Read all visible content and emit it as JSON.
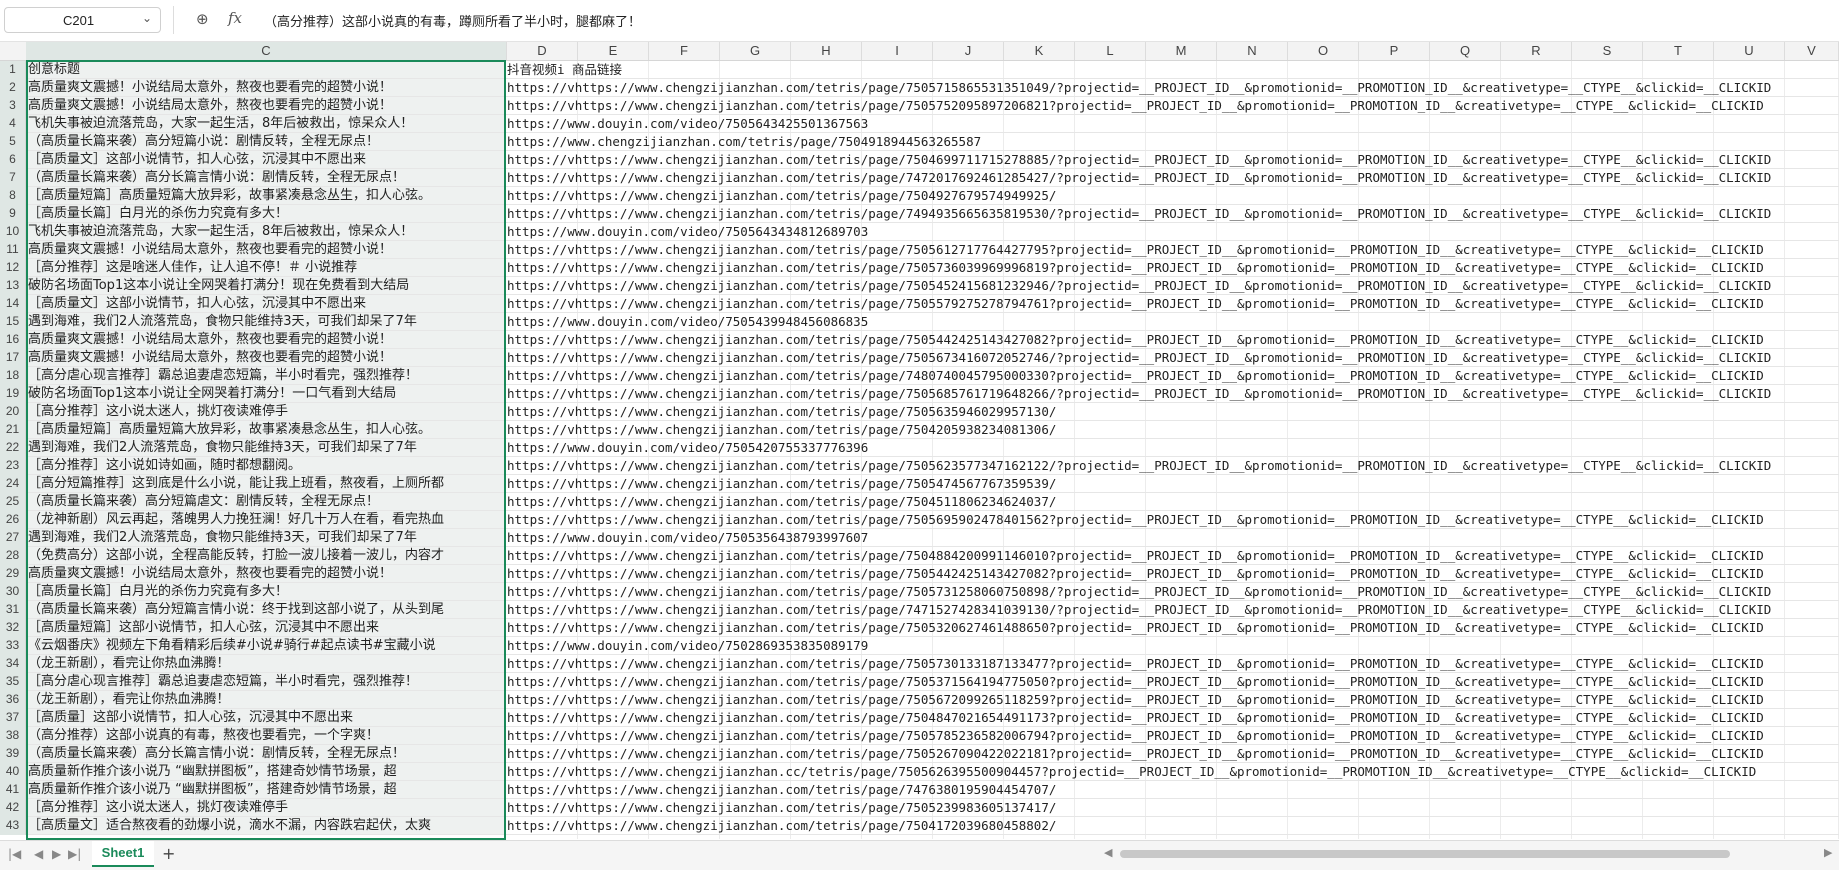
{
  "formula_bar": {
    "cell_ref": "C201",
    "dropdown_icon": "chevron-down-icon",
    "zoom_icon": "zoom-icon",
    "fx_label": "fx",
    "formula": "（高分推荐）这部小说真的有毒，蹲厕所看了半小时，腿都麻了！"
  },
  "columns": [
    "C",
    "D",
    "E",
    "F",
    "G",
    "H",
    "I",
    "J",
    "K",
    "L",
    "M",
    "N",
    "O",
    "P",
    "Q",
    "R",
    "S",
    "T",
    "U",
    "V"
  ],
  "rows": [
    {
      "n": "1",
      "c": "创意标题",
      "d": "抖音视频i 商品链接"
    },
    {
      "n": "2",
      "c": "高质量爽文震撼！小说结局太意外，熬夜也要看完的超赞小说！",
      "d": "https://vhttps://www.chengzijianzhan.com/tetris/page/7505715865531351049/?projectid=__PROJECT_ID__&promotionid=__PROMOTION_ID__&creativetype=__CTYPE__&clickid=__CLICKID"
    },
    {
      "n": "3",
      "c": "高质量爽文震撼！小说结局太意外，熬夜也要看完的超赞小说！",
      "d": "https://vhttps://www.chengzijianzhan.com/tetris/page/7505752095897206821?projectid=__PROJECT_ID__&promotionid=__PROMOTION_ID__&creativetype=__CTYPE__&clickid=__CLICKID"
    },
    {
      "n": "4",
      "c": "飞机失事被迫流落荒岛，大家一起生活，8年后被救出，惊呆众人！",
      "d": "https://www.douyin.com/video/7505643425501367563"
    },
    {
      "n": "5",
      "c": "（高质量长篇来袭）高分短篇小说：剧情反转，全程无尿点！",
      "d": "https://www.chengzijianzhan.com/tetris/page/7504918944563265587"
    },
    {
      "n": "6",
      "c": "［高质量文］这部小说情节，扣人心弦，沉浸其中不愿出来",
      "d": "https://vhttps://www.chengzijianzhan.com/tetris/page/7504699711715278885/?projectid=__PROJECT_ID__&promotionid=__PROMOTION_ID__&creativetype=__CTYPE__&clickid=__CLICKID"
    },
    {
      "n": "7",
      "c": "（高质量长篇来袭）高分长篇言情小说：剧情反转，全程无尿点！",
      "d": "https://vhttps://www.chengzijianzhan.com/tetris/page/7472017692461285427/?projectid=__PROJECT_ID__&promotionid=__PROMOTION_ID__&creativetype=__CTYPE__&clickid=__CLICKID"
    },
    {
      "n": "8",
      "c": "［高质量短篇］高质量短篇大放异彩，故事紧凑悬念丛生，扣人心弦。",
      "d": "https://vhttps://www.chengzijianzhan.com/tetris/page/7504927679574949925/"
    },
    {
      "n": "9",
      "c": "［高质量长篇］白月光的杀伤力究竟有多大！",
      "d": "https://vhttps://www.chengzijianzhan.com/tetris/page/7494935665635819530/?projectid=__PROJECT_ID__&promotionid=__PROMOTION_ID__&creativetype=__CTYPE__&clickid=__CLICKID"
    },
    {
      "n": "10",
      "c": "飞机失事被迫流落荒岛，大家一起生活，8年后被救出，惊呆众人！",
      "d": "https://www.douyin.com/video/7505643434812689703"
    },
    {
      "n": "11",
      "c": "高质量爽文震撼！小说结局太意外，熬夜也要看完的超赞小说！",
      "d": "https://vhttps://www.chengzijianzhan.com/tetris/page/7505612717764427795?projectid=__PROJECT_ID__&promotionid=__PROMOTION_ID__&creativetype=__CTYPE__&clickid=__CLICKID"
    },
    {
      "n": "12",
      "c": "［高分推荐］这是啥迷人佳作，让人追不停！＃ 小说推荐",
      "d": "https://vhttps://www.chengzijianzhan.com/tetris/page/7505736039969996819?projectid=__PROJECT_ID__&promotionid=__PROMOTION_ID__&creativetype=__CTYPE__&clickid=__CLICKID"
    },
    {
      "n": "13",
      "c": "破防名场面Top1这本小说让全网哭着打满分！现在免费看到大结局",
      "d": "https://vhttps://www.chengzijianzhan.com/tetris/page/7505452415681232946/?projectid=__PROJECT_ID__&promotionid=__PROMOTION_ID__&creativetype=__CTYPE__&clickid=__CLICKID"
    },
    {
      "n": "14",
      "c": "［高质量文］这部小说情节，扣人心弦，沉浸其中不愿出来",
      "d": "https://vhttps://www.chengzijianzhan.com/tetris/page/7505579275278794761?projectid=__PROJECT_ID__&promotionid=__PROMOTION_ID__&creativetype=__CTYPE__&clickid=__CLICKID"
    },
    {
      "n": "15",
      "c": "遇到海难，我们2人流落荒岛，食物只能维持3天，可我们却呆了7年",
      "d": "https://www.douyin.com/video/7505439948456086835"
    },
    {
      "n": "16",
      "c": "高质量爽文震撼！小说结局太意外，熬夜也要看完的超赞小说！",
      "d": "https://vhttps://www.chengzijianzhan.com/tetris/page/7505442425143427082?projectid=__PROJECT_ID__&promotionid=__PROMOTION_ID__&creativetype=__CTYPE__&clickid=__CLICKID"
    },
    {
      "n": "17",
      "c": "高质量爽文震撼！小说结局太意外，熬夜也要看完的超赞小说！",
      "d": "https://vhttps://www.chengzijianzhan.com/tetris/page/7505673416072052746/?projectid=__PROJECT_ID__&promotionid=__PROMOTION_ID__&creativetype=__CTYPE__&clickid=__CLICKID"
    },
    {
      "n": "18",
      "c": "［高分虐心现言推荐］霸总追妻虐恋短篇，半小时看完，强烈推荐！",
      "d": "https://vhttps://www.chengzijianzhan.com/tetris/page/7480740045795000330?projectid=__PROJECT_ID__&promotionid=__PROMOTION_ID__&creativetype=__CTYPE__&clickid=__CLICKID"
    },
    {
      "n": "19",
      "c": "破防名场面Top1这本小说让全网哭着打满分！一口气看到大结局",
      "d": "https://vhttps://www.chengzijianzhan.com/tetris/page/7505685761719648266/?projectid=__PROJECT_ID__&promotionid=__PROMOTION_ID__&creativetype=__CTYPE__&clickid=__CLICKID"
    },
    {
      "n": "20",
      "c": "［高分推荐］这小说太迷人，挑灯夜读难停手",
      "d": "https://vhttps://www.chengzijianzhan.com/tetris/page/7505635946029957130/"
    },
    {
      "n": "21",
      "c": "［高质量短篇］高质量短篇大放异彩，故事紧凑悬念丛生，扣人心弦。",
      "d": "https://vhttps://www.chengzijianzhan.com/tetris/page/7504205938234081306/"
    },
    {
      "n": "22",
      "c": "遇到海难，我们2人流落荒岛，食物只能维持3天，可我们却呆了7年",
      "d": "https://www.douyin.com/video/7505420755337776396"
    },
    {
      "n": "23",
      "c": "［高分推荐］这小说如诗如画，随时都想翻阅。",
      "d": "https://vhttps://www.chengzijianzhan.com/tetris/page/7505623577347162122/?projectid=__PROJECT_ID__&promotionid=__PROMOTION_ID__&creativetype=__CTYPE__&clickid=__CLICKID"
    },
    {
      "n": "24",
      "c": "［高分短篇推荐］这到底是什么小说，能让我上班看，熬夜看，上厕所都",
      "d": "https://vhttps://www.chengzijianzhan.com/tetris/page/7505474567767359539/"
    },
    {
      "n": "25",
      "c": "（高质量长篇来袭）高分短篇虐文：剧情反转，全程无尿点！",
      "d": "https://vhttps://www.chengzijianzhan.com/tetris/page/7504511806234624037/"
    },
    {
      "n": "26",
      "c": "（龙神新剧）风云再起，落魄男人力挽狂澜！好几十万人在看，看完热血",
      "d": "https://vhttps://www.chengzijianzhan.com/tetris/page/7505695902478401562?projectid=__PROJECT_ID__&promotionid=__PROMOTION_ID__&creativetype=__CTYPE__&clickid=__CLICKID"
    },
    {
      "n": "27",
      "c": "遇到海难，我们2人流落荒岛，食物只能维持3天，可我们却呆了7年",
      "d": "https://www.douyin.com/video/7505356438793997607"
    },
    {
      "n": "28",
      "c": "（免费高分）这部小说，全程高能反转，打脸一波儿接着一波儿，内容才",
      "d": "https://vhttps://www.chengzijianzhan.com/tetris/page/7504884200991146010?projectid=__PROJECT_ID__&promotionid=__PROMOTION_ID__&creativetype=__CTYPE__&clickid=__CLICKID"
    },
    {
      "n": "29",
      "c": "高质量爽文震撼！小说结局太意外，熬夜也要看完的超赞小说！",
      "d": "https://vhttps://www.chengzijianzhan.com/tetris/page/7505442425143427082?projectid=__PROJECT_ID__&promotionid=__PROMOTION_ID__&creativetype=__CTYPE__&clickid=__CLICKID"
    },
    {
      "n": "30",
      "c": "［高质量长篇］白月光的杀伤力究竟有多大！",
      "d": "https://vhttps://www.chengzijianzhan.com/tetris/page/7505731258060750898/?projectid=__PROJECT_ID__&promotionid=__PROMOTION_ID__&creativetype=__CTYPE__&clickid=__CLICKID"
    },
    {
      "n": "31",
      "c": "（高质量长篇来袭）高分短篇言情小说：终于找到这部小说了，从头到尾",
      "d": "https://vhttps://www.chengzijianzhan.com/tetris/page/7471527428341039130/?projectid=__PROJECT_ID__&promotionid=__PROMOTION_ID__&creativetype=__CTYPE__&clickid=__CLICKID"
    },
    {
      "n": "32",
      "c": "［高质量短篇］这部小说情节，扣人心弦，沉浸其中不愿出来",
      "d": "https://vhttps://www.chengzijianzhan.com/tetris/page/7505320627461488650?projectid=__PROJECT_ID__&promotionid=__PROMOTION_ID__&creativetype=__CTYPE__&clickid=__CLICKID"
    },
    {
      "n": "33",
      "c": "《云烟番庆》视频左下角看精彩后续#小说#骑行#起点读书#宝藏小说",
      "d": "https://www.douyin.com/video/7502869353835089179"
    },
    {
      "n": "34",
      "c": "（龙王新剧），看完让你热血沸腾！",
      "d": "https://vhttps://www.chengzijianzhan.com/tetris/page/7505730133187133477?projectid=__PROJECT_ID__&promotionid=__PROMOTION_ID__&creativetype=__CTYPE__&clickid=__CLICKID"
    },
    {
      "n": "35",
      "c": "［高分虐心现言推荐］霸总追妻虐恋短篇，半小时看完，强烈推荐！",
      "d": "https://vhttps://www.chengzijianzhan.com/tetris/page/7505371564194775050?projectid=__PROJECT_ID__&promotionid=__PROMOTION_ID__&creativetype=__CTYPE__&clickid=__CLICKID"
    },
    {
      "n": "36",
      "c": "（龙王新剧），看完让你热血沸腾！",
      "d": "https://vhttps://www.chengzijianzhan.com/tetris/page/7505672099265118259?projectid=__PROJECT_ID__&promotionid=__PROMOTION_ID__&creativetype=__CTYPE__&clickid=__CLICKID"
    },
    {
      "n": "37",
      "c": "［高质量］这部小说情节，扣人心弦，沉浸其中不愿出来",
      "d": "https://vhttps://www.chengzijianzhan.com/tetris/page/7504847021654491173?projectid=__PROJECT_ID__&promotionid=__PROMOTION_ID__&creativetype=__CTYPE__&clickid=__CLICKID"
    },
    {
      "n": "38",
      "c": "（高分推荐）这部小说真的有毒，熬夜也要看完，一个字爽！",
      "d": "https://vhttps://www.chengzijianzhan.com/tetris/page/7505785236582006794?projectid=__PROJECT_ID__&promotionid=__PROMOTION_ID__&creativetype=__CTYPE__&clickid=__CLICKID"
    },
    {
      "n": "39",
      "c": "（高质量长篇来袭）高分长篇言情小说：剧情反转，全程无尿点！",
      "d": "https://vhttps://www.chengzijianzhan.com/tetris/page/7505267090422022181?projectid=__PROJECT_ID__&promotionid=__PROMOTION_ID__&creativetype=__CTYPE__&clickid=__CLICKID"
    },
    {
      "n": "40",
      "c": "高质量新作推介该小说乃 “幽默拼图板”，搭建奇妙情节场景，超",
      "d": "https://vhttps://www.chengzijianzhan.cc/tetris/page/7505626395500904457?projectid=__PROJECT_ID__&promotionid=__PROMOTION_ID__&creativetype=__CTYPE__&clickid=__CLICKID"
    },
    {
      "n": "41",
      "c": "高质量新作推介该小说乃 “幽默拼图板”，搭建奇妙情节场景，超",
      "d": "https://vhttps://www.chengzijianzhan.com/tetris/page/7476380195904454707/"
    },
    {
      "n": "42",
      "c": "［高分推荐］这小说太迷人，挑灯夜读难停手",
      "d": "https://vhttps://www.chengzijianzhan.com/tetris/page/7505239983605137417/"
    },
    {
      "n": "43",
      "c": "［高质量文］适合熬夜看的劲爆小说，滴水不漏，内容跌宕起伏，太爽",
      "d": "https://vhttps://www.chengzijianzhan.com/tetris/page/7504172039680458802/"
    }
  ],
  "sheet_tabs": [
    "Sheet1"
  ],
  "bottom_bar": {
    "add_tab": "+",
    "nav_first": "|◀",
    "nav_prev": "◀",
    "nav_next": "▶",
    "nav_last": "▶|",
    "scroll_left": "◀",
    "scroll_right": "▶"
  },
  "colors": {
    "selection": "#1a8a5a",
    "header_bg": "#f3f3f3",
    "selected_header_bg": "#dfe7e4"
  }
}
